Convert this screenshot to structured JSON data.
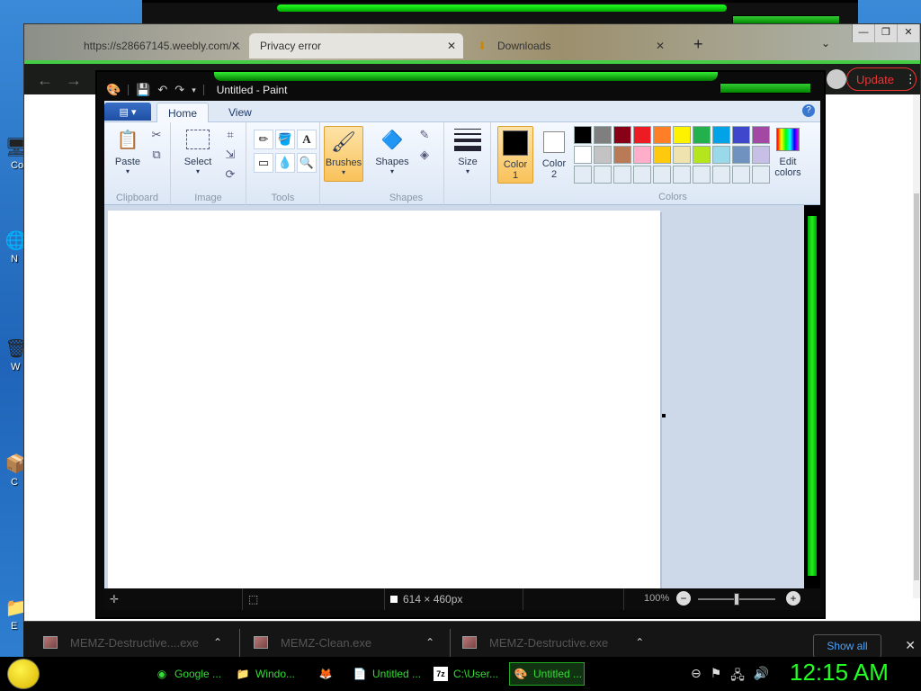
{
  "browser": {
    "tabs": [
      {
        "label": "https://s28667145.weebly.com/...",
        "active": false
      },
      {
        "label": "Privacy error",
        "active": true
      },
      {
        "label": "Downloads",
        "active": false
      }
    ],
    "new_tab": "+",
    "update_label": "Update",
    "menu_dots": "⋮",
    "window_controls": [
      "—",
      "❐",
      "✕"
    ]
  },
  "paint": {
    "title": "Untitled - Paint",
    "ribbon_tabs": {
      "home": "Home",
      "view": "View"
    },
    "groups": {
      "clipboard": "Clipboard",
      "image": "Image",
      "tools": "Tools",
      "shapes": "Shapes",
      "colors": "Colors"
    },
    "buttons": {
      "paste": "Paste",
      "select": "Select",
      "brushes": "Brushes",
      "shapes": "Shapes",
      "size": "Size",
      "color1": "Color\n1",
      "color1_line1": "Color",
      "color1_line2": "1",
      "color2_line1": "Color",
      "color2_line2": "2",
      "edit_colors_line1": "Edit",
      "edit_colors_line2": "colors"
    },
    "palette": [
      "#000000",
      "#7f7f7f",
      "#880015",
      "#ed1c24",
      "#ff7f27",
      "#fff200",
      "#22b14c",
      "#00a2e8",
      "#3f48cc",
      "#a349a4",
      "#ffffff",
      "#c3c3c3",
      "#b97a57",
      "#ffaec9",
      "#ffc90e",
      "#efe4b0",
      "#b5e61d",
      "#99d9ea",
      "#7092be",
      "#c8bfe7",
      "#e3ebf5",
      "#e3ebf5",
      "#e3ebf5",
      "#e3ebf5",
      "#e3ebf5",
      "#e3ebf5",
      "#e3ebf5",
      "#e3ebf5",
      "#e3ebf5",
      "#e3ebf5"
    ],
    "color1": "#000000",
    "color2": "#ffffff",
    "status": {
      "dimensions": "614 × 460px",
      "zoom": "100%"
    }
  },
  "downloads": {
    "items": [
      {
        "name": "MEMZ-Destructive....exe"
      },
      {
        "name": "MEMZ-Clean.exe"
      },
      {
        "name": "MEMZ-Destructive.exe"
      }
    ],
    "show_all": "Show all",
    "close": "✕"
  },
  "desktop": {
    "icons": [
      {
        "label": "Co",
        "icon": "computer-icon"
      },
      {
        "label": "N",
        "icon": "network-icon"
      },
      {
        "label": "W",
        "icon": "wastebasket-icon"
      },
      {
        "label": "C",
        "icon": "app-icon"
      },
      {
        "label": "E",
        "icon": "explorer-icon"
      }
    ]
  },
  "taskbar": {
    "tasks": [
      {
        "label": "Google ...",
        "icon": "chrome-icon"
      },
      {
        "label": "Windo...",
        "icon": "folder-icon"
      },
      {
        "label": "",
        "icon": "firefox-icon"
      },
      {
        "label": "Untitled ...",
        "icon": "notepad-icon"
      },
      {
        "label": "C:\\User...",
        "icon": "7zip-icon"
      },
      {
        "label": "Untitled ...",
        "icon": "paint-icon"
      }
    ],
    "clock": "12:15 AM"
  }
}
